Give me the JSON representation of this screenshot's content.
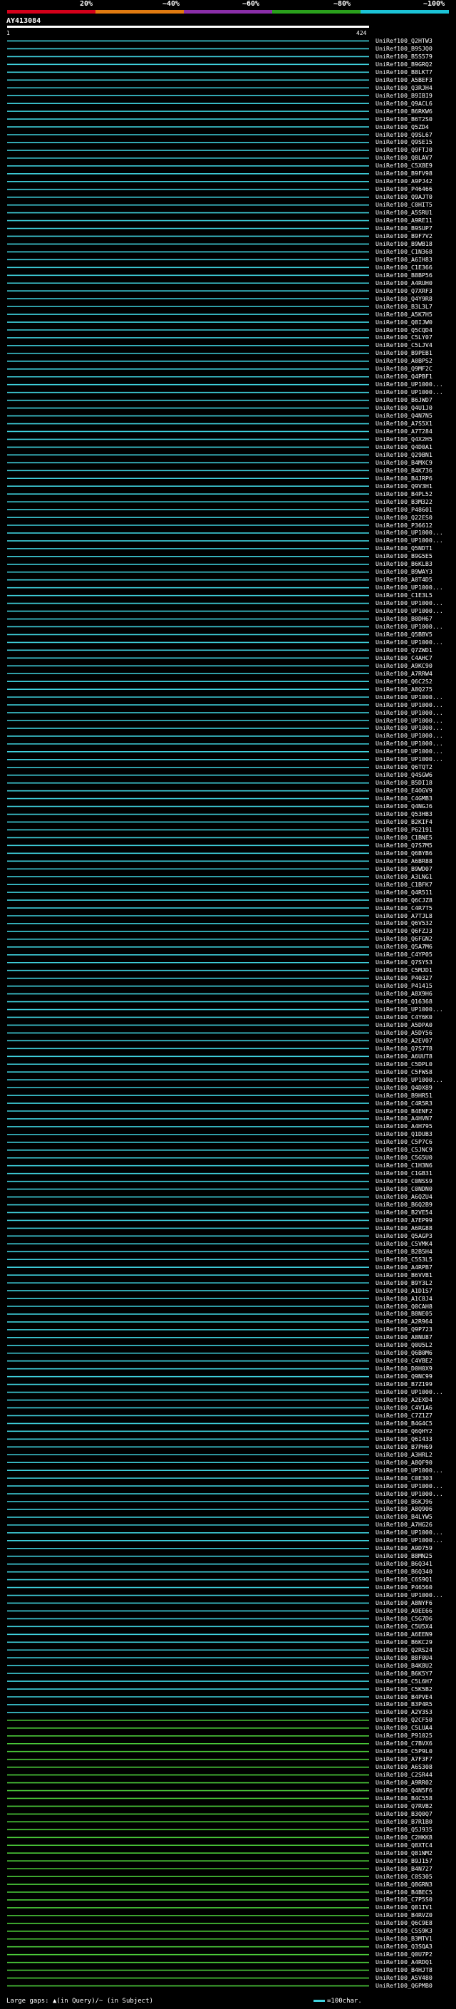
{
  "legend": {
    "percent_labels": [
      "20%",
      "~40%",
      "~60%",
      "~80%",
      "~100%"
    ],
    "colors": [
      "#d4001a",
      "#e07a10",
      "#8a2ea8",
      "#2aa01c",
      "#1cc4d8"
    ]
  },
  "query": {
    "title": "AY413084",
    "start_label": "1",
    "end_label": "424"
  },
  "hit_colors": {
    "cyan": "#3fd0dc",
    "green": "#4ccd3a"
  },
  "hits": [
    "UniRef100_Q2HTW3",
    "UniRef100_B9SJQ0",
    "UniRef100_B5S579",
    "UniRef100_B9GRQ2",
    "UniRef100_B8LKT7",
    "UniRef100_A5BEF3",
    "UniRef100_Q3RJH4",
    "UniRef100_B9IBI9",
    "UniRef100_Q9ACL6",
    "UniRef100_B6RKW6",
    "UniRef100_B6T2S0",
    "UniRef100_Q5ZD4",
    "UniRef100_Q9SL67",
    "UniRef100_Q9SE15",
    "UniRef100_Q9FTJ0",
    "UniRef100_Q8LAV7",
    "UniRef100_C5X8E9",
    "UniRef100_B9FV98",
    "UniRef100_A9PJ42",
    "UniRef100_P46466",
    "UniRef100_Q9AJT0",
    "UniRef100_C0HIT5",
    "UniRef100_A5SRU1",
    "UniRef100_A9RE11",
    "UniRef100_B9SUP7",
    "UniRef100_B9F7V2",
    "UniRef100_B9WB18",
    "UniRef100_C1N368",
    "UniRef100_A6IH83",
    "UniRef100_C1E366",
    "UniRef100_B8BP56",
    "UniRef100_A4RUH0",
    "UniRef100_Q7XRF3",
    "UniRef100_Q4Y9R8",
    "UniRef100_B3L3L7",
    "UniRef100_A5K7H5",
    "UniRef100_Q8IJW0",
    "UniRef100_Q5CQD4",
    "UniRef100_C5LY07",
    "UniRef100_C5LJV4",
    "UniRef100_B9PEB1",
    "UniRef100_A0BPS2",
    "UniRef100_Q9MF2C",
    "UniRef100_Q4PBF1",
    "UniRef100_UP1000...",
    "UniRef100_UP1000...",
    "UniRef100_B6JWD7",
    "UniRef100_Q4U1J0",
    "UniRef100_Q4N7N5",
    "UniRef100_A7S5X1",
    "UniRef100_A7T284",
    "UniRef100_Q4X2H5",
    "UniRef100_Q4D0A1",
    "UniRef100_Q29BN1",
    "UniRef100_B4MXC9",
    "UniRef100_B4K736",
    "UniRef100_B4JRP6",
    "UniRef100_Q9V3H1",
    "UniRef100_B4PL52",
    "UniRef100_B3M322",
    "UniRef100_P48601",
    "UniRef100_Q22ES0",
    "UniRef100_P36612",
    "UniRef100_UP1000...",
    "UniRef100_UP1000...",
    "UniRef100_Q5NDT1",
    "UniRef100_B9G5E5",
    "UniRef100_B6KLB3",
    "UniRef100_B9WAY3",
    "UniRef100_A0T4D5",
    "UniRef100_UP1000...",
    "UniRef100_C1E3L5",
    "UniRef100_UP1000...",
    "UniRef100_UP1000...",
    "UniRef100_B0DH67",
    "UniRef100_UP1000...",
    "UniRef100_Q5BBV5",
    "UniRef100_UP1000...",
    "UniRef100_Q7ZWD1",
    "UniRef100_C4AHC7",
    "UniRef100_A9KC90",
    "UniRef100_A7RRW4",
    "UniRef100_Q6C2S2",
    "UniRef100_A8Q275",
    "UniRef100_UP1000...",
    "UniRef100_UP1000...",
    "UniRef100_UP1000...",
    "UniRef100_UP1000...",
    "UniRef100_UP1000...",
    "UniRef100_UP1000...",
    "UniRef100_UP1000...",
    "UniRef100_UP1000...",
    "UniRef100_UP1000...",
    "UniRef100_Q6TQT2",
    "UniRef100_Q4SGW6",
    "UniRef100_B5DI18",
    "UniRef100_E4OGV9",
    "UniRef100_C4GMB3",
    "UniRef100_Q4NGJ6",
    "UniRef100_Q53HB3",
    "UniRef100_B2KIF4",
    "UniRef100_P62191",
    "UniRef100_C1BNE5",
    "UniRef100_Q7S7M5",
    "UniRef100_Q6BYB6",
    "UniRef100_A6BR88",
    "UniRef100_B9WD07",
    "UniRef100_A3LNG1",
    "UniRef100_C1BFK7",
    "UniRef100_Q4R511",
    "UniRef100_Q6CJZ8",
    "UniRef100_C4R7T5",
    "UniRef100_A7TJL8",
    "UniRef100_Q6V532",
    "UniRef100_Q6FZJ3",
    "UniRef100_Q6FGN2",
    "UniRef100_Q5A7M6",
    "UniRef100_C4YP05",
    "UniRef100_Q7SYS3",
    "UniRef100_C5MJD1",
    "UniRef100_P40327",
    "UniRef100_P41415",
    "UniRef100_A8X9H6",
    "UniRef100_Q16368",
    "UniRef100_UP1000...",
    "UniRef100_C4Y6K0",
    "UniRef100_A5DPA0",
    "UniRef100_A5DY56",
    "UniRef100_A2EV07",
    "UniRef100_Q7S7T8",
    "UniRef100_A6UUT8",
    "UniRef100_C5DPL0",
    "UniRef100_C5FWS8",
    "UniRef100_UP1000...",
    "UniRef100_Q4DX89",
    "UniRef100_B9HR51",
    "UniRef100_C4R5R3",
    "UniRef100_B4ENF2",
    "UniRef100_A4HVN7",
    "UniRef100_A4H795",
    "UniRef100_Q1DUB3",
    "UniRef100_C5P7C6",
    "UniRef100_C5JNC9",
    "UniRef100_C5G5U0",
    "UniRef100_C1H3N6",
    "UniRef100_C1GB31",
    "UniRef100_C0NSS9",
    "UniRef100_C0NDN0",
    "UniRef100_A6QZU4",
    "UniRef100_B6Q2B9",
    "UniRef100_B2VE54",
    "UniRef100_A7EP99",
    "UniRef100_A6RG88",
    "UniRef100_Q5AGP3",
    "UniRef100_C5VMK4",
    "UniRef100_B2B5H4",
    "UniRef100_C5S3L5",
    "UniRef100_A4RPB7",
    "UniRef100_B6VVB1",
    "UniRef100_B9Y3L2",
    "UniRef100_A1D1S7",
    "UniRef100_A1C8J4",
    "UniRef100_Q0CAH8",
    "UniRef100_B8NE05",
    "UniRef100_A2R964",
    "UniRef100_Q9P723",
    "UniRef100_A8NU87",
    "UniRef100_Q0U5L2",
    "UniRef100_Q6B0M6",
    "UniRef100_C4VBE2",
    "UniRef100_D0H0X9",
    "UniRef100_Q9NC99",
    "UniRef100_B7Z199",
    "UniRef100_UP1000...",
    "UniRef100_A2EXD4",
    "UniRef100_C4V1A6",
    "UniRef100_C7Z1Z7",
    "UniRef100_B4G4C5",
    "UniRef100_Q6QHY2",
    "UniRef100_Q6I433",
    "UniRef100_B7PH69",
    "UniRef100_A3HRL2",
    "UniRef100_A8QF90",
    "UniRef100_UP1000...",
    "UniRef100_C0E303",
    "UniRef100_UP1000...",
    "UniRef100_UP1000...",
    "UniRef100_B6KJ96",
    "UniRef100_A8Q906",
    "UniRef100_B4LYW5",
    "UniRef100_A7HG26",
    "UniRef100_UP1000...",
    "UniRef100_UP1000...",
    "UniRef100_A9D759",
    "UniRef100_B8MN25",
    "UniRef100_B6Q341",
    "UniRef100_B6Q340",
    "UniRef100_C6S9Q1",
    "UniRef100_P46560",
    "UniRef100_UP1000...",
    "UniRef100_A8NYF6",
    "UniRef100_A9EE66",
    "UniRef100_C5G7D6",
    "UniRef100_C5U5X4",
    "UniRef100_A6EEN9",
    "UniRef100_B6KC29",
    "UniRef100_Q2RS24",
    "UniRef100_B8F0U4",
    "UniRef100_B4K8U2",
    "UniRef100_B6K5Y7",
    "UniRef100_C5L6H7",
    "UniRef100_C5K5B2",
    "UniRef100_B4PVE4",
    "UniRef100_B3P4R5",
    "UniRef100_A2V3S3",
    "UniRef100_Q2CF50",
    "UniRef100_C5LUA4",
    "UniRef100_P91025",
    "UniRef100_C7BVX6",
    "UniRef100_C5P9L0",
    "UniRef100_A7F3F7",
    "UniRef100_A6S308",
    "UniRef100_C2SR44",
    "UniRef100_A9RR02",
    "UniRef100_Q4N5F6",
    "UniRef100_B4C558",
    "UniRef100_Q7RVB2",
    "UniRef100_B3Q0Q7",
    "UniRef100_B7R1B0",
    "UniRef100_Q5J935",
    "UniRef100_C2HKK8",
    "UniRef100_Q8XTC4",
    "UniRef100_Q81NM2",
    "UniRef100_B9J157",
    "UniRef100_B4N727",
    "UniRef100_C0S305",
    "UniRef100_Q8GRN3",
    "UniRef100_B4BEC5",
    "UniRef100_C7P5S0",
    "UniRef100_Q81IV1",
    "UniRef100_B4RVZ0",
    "UniRef100_Q6C9E8",
    "UniRef100_C5S9K3",
    "UniRef100_B3MTV1",
    "UniRef100_Q3SQA3",
    "UniRef100_Q0U7P2",
    "UniRef100_A4RDQ1",
    "UniRef100_B4HJT8",
    "UniRef100_A5V480",
    "UniRef100_Q6PMB0"
  ],
  "footer": {
    "left": "Large gaps: ▲(in Query)/~ (in Subject)",
    "right": "=100char."
  }
}
